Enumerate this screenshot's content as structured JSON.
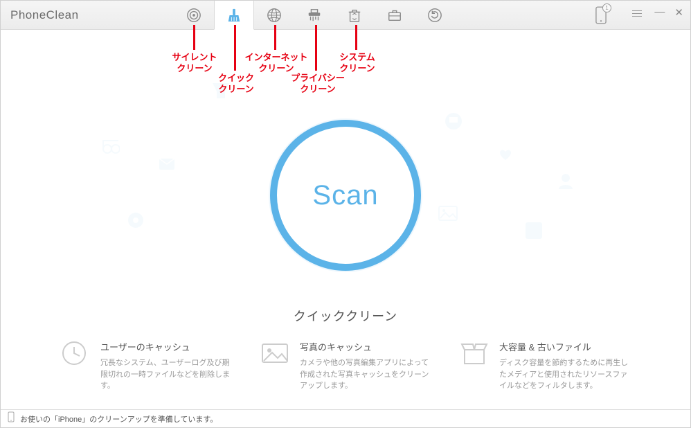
{
  "app_title": "PhoneClean",
  "toolbar": {
    "silent_clean": "サイレント\nクリーン",
    "quick_clean": "クイック\nクリーン",
    "internet_clean": "インターネット\nクリーン",
    "privacy_clean": "プライバシー\nクリーン",
    "system_clean": "システム\nクリーン"
  },
  "phone_badge": "1",
  "scan_label": "Scan",
  "section_title": "クイッククリーン",
  "features": [
    {
      "title": "ユーザーのキャッシュ",
      "desc": "冗長なシステム、ユーザーログ及び期限切れの一時ファイルなどを削除します。"
    },
    {
      "title": "写真のキャッシュ",
      "desc": "カメラや他の写真編集アプリによって作成された写真キャッシュをクリーンアップします。"
    },
    {
      "title": "大容量 & 古いファイル",
      "desc": "ディスク容量を節約するために再生したメディアと使用されたリソースファイルなどをフィルタします。"
    }
  ],
  "status_text": "お使いの「iPhone」のクリーンアップを準備しています。"
}
